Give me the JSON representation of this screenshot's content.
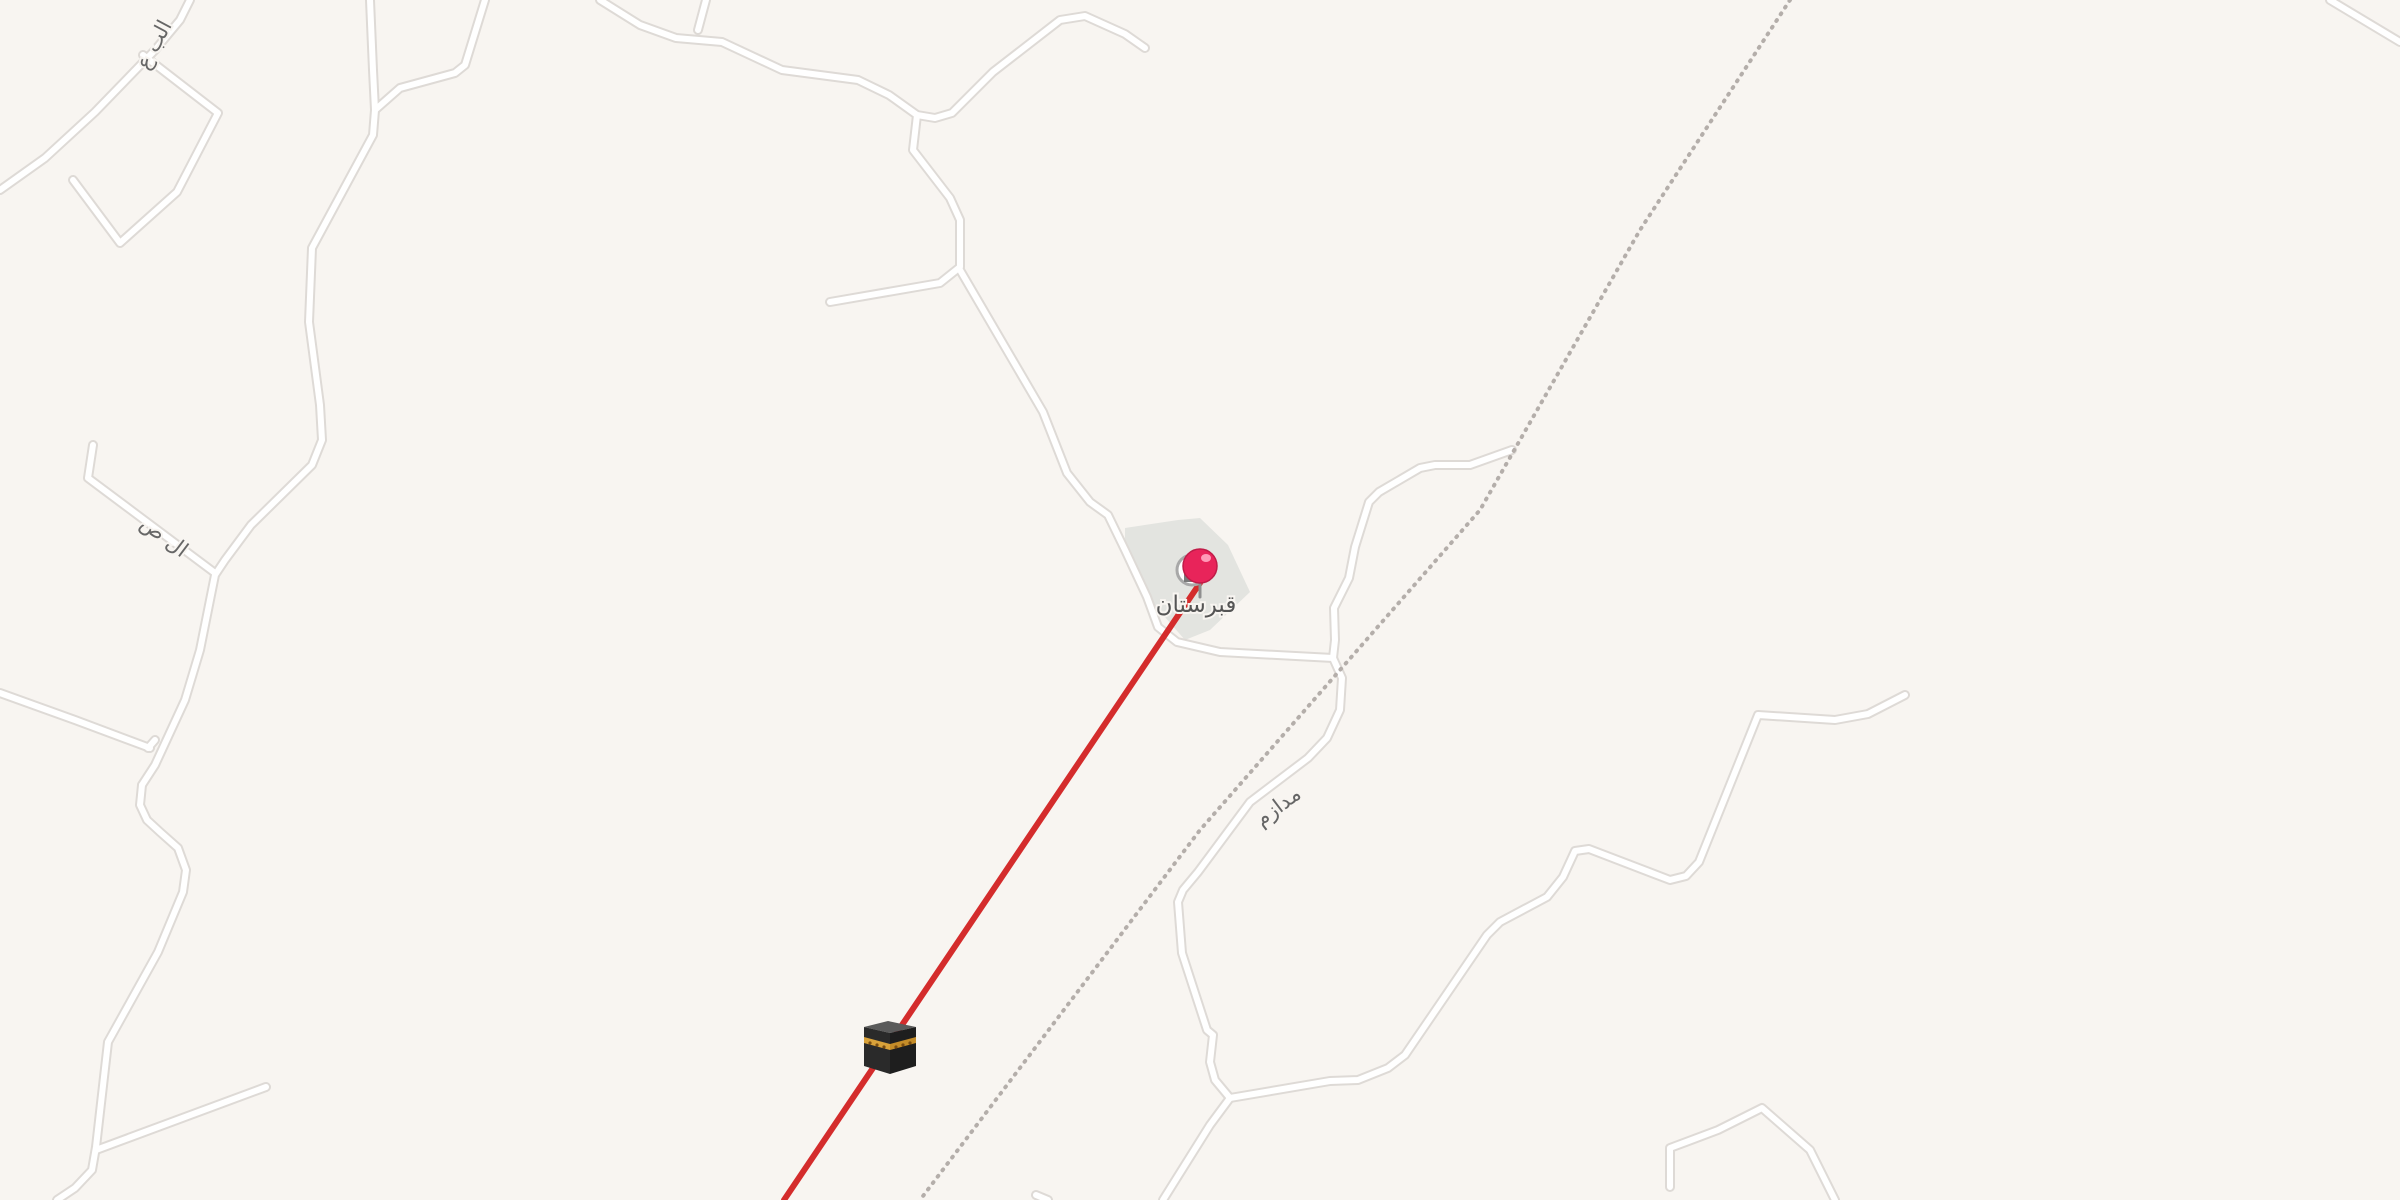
{
  "map": {
    "colors": {
      "background": "#f8f5f1",
      "road": "#ffffff",
      "road_casing": "#dedad6",
      "boundary": "#b4aeaa",
      "qibla_line": "#d42c2c",
      "marker": "#e8245a",
      "poi_area": "#e3e4e0"
    },
    "road_labels": [
      {
        "id": "road-label-top",
        "text": "الب ع"
      },
      {
        "id": "road-label-west",
        "text": "ال ص"
      },
      {
        "id": "road-label-east",
        "text": "مدازم"
      }
    ],
    "location": {
      "label": "قبرستان",
      "marker_icon": "map-pin-icon",
      "poi_icon": "cemetery-icon"
    },
    "qibla": {
      "icon": "kaaba-icon"
    }
  }
}
